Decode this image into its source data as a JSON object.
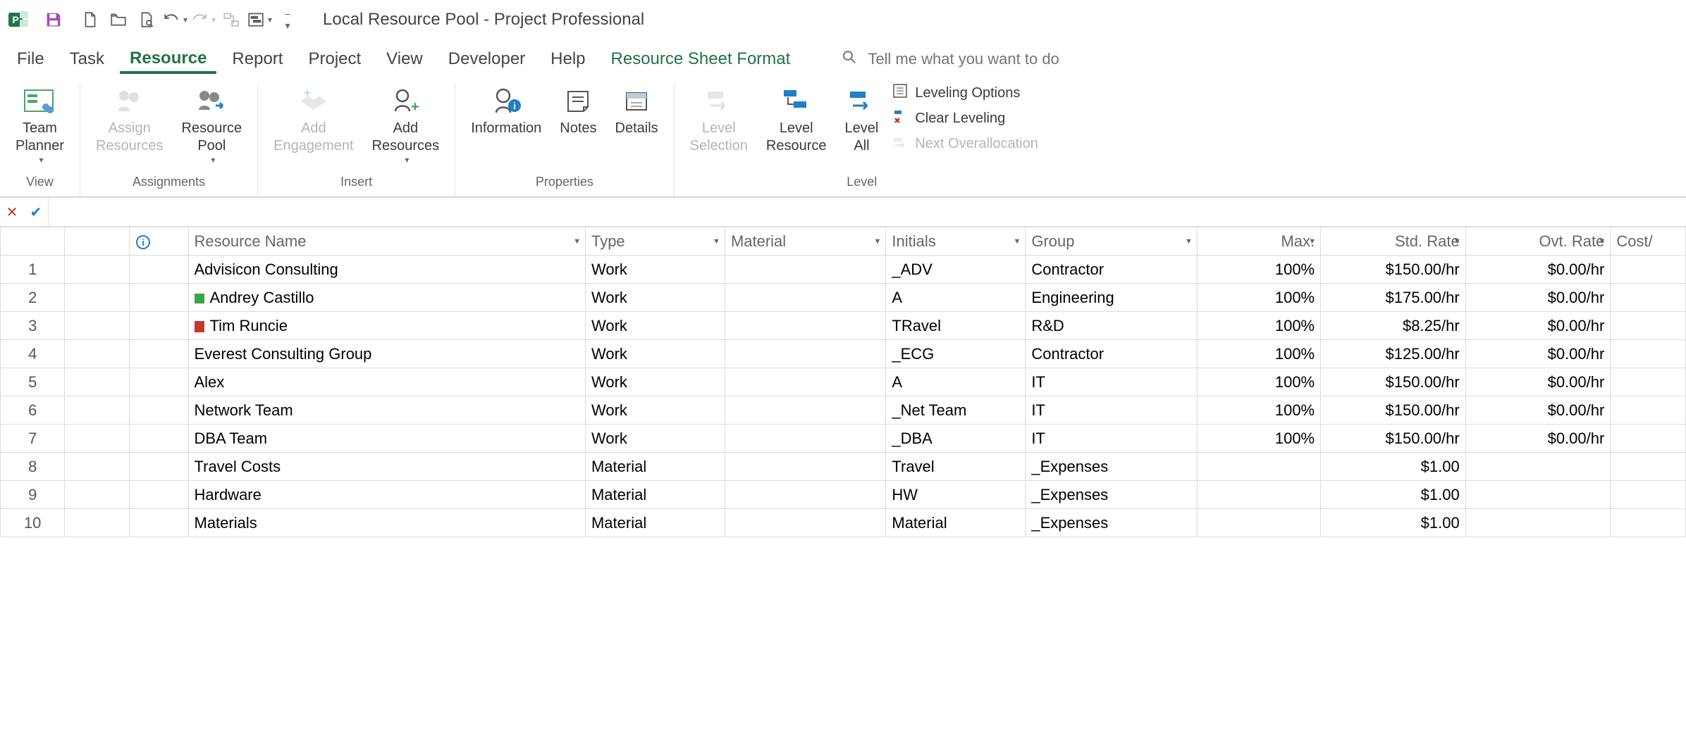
{
  "app": {
    "title": "Local Resource Pool  -  Project Professional"
  },
  "qat_tips": {
    "save": "Save",
    "new": "New",
    "open": "Open",
    "print": "Print Preview",
    "undo": "Undo",
    "redo": "Redo",
    "link": "Link",
    "gantt": "Gantt",
    "custom": "Customize"
  },
  "tabs": [
    "File",
    "Task",
    "Resource",
    "Report",
    "Project",
    "View",
    "Developer",
    "Help"
  ],
  "contextual_tab": "Resource Sheet Format",
  "tellme_placeholder": "Tell me what you want to do",
  "ribbon": {
    "groups": {
      "view": {
        "label": "View",
        "team_planner": "Team\nPlanner"
      },
      "assignments": {
        "label": "Assignments",
        "assign": "Assign\nResources",
        "pool": "Resource\nPool"
      },
      "insert": {
        "label": "Insert",
        "engagement": "Add\nEngagement",
        "add_res": "Add\nResources"
      },
      "properties": {
        "label": "Properties",
        "info": "Information",
        "notes": "Notes",
        "details": "Details"
      },
      "level": {
        "label": "Level",
        "sel": "Level\nSelection",
        "res": "Level\nResource",
        "all": "Level\nAll",
        "opts": "Leveling Options",
        "clear": "Clear Leveling",
        "next": "Next Overallocation"
      }
    }
  },
  "columns": {
    "name": "Resource Name",
    "type": "Type",
    "material": "Material",
    "initials": "Initials",
    "group": "Group",
    "max": "Max.",
    "std": "Std. Rate",
    "ovt": "Ovt. Rate",
    "cost": "Cost/"
  },
  "rows": [
    {
      "num": "1",
      "badge": "",
      "name": "Advisicon Consulting",
      "type": "Work",
      "material": "",
      "initials": "_ADV",
      "group": "Contractor",
      "max": "100%",
      "std": "$150.00/hr",
      "ovt": "$0.00/hr"
    },
    {
      "num": "2",
      "badge": "green",
      "name": "Andrey Castillo",
      "type": "Work",
      "material": "",
      "initials": "A",
      "group": "Engineering",
      "max": "100%",
      "std": "$175.00/hr",
      "ovt": "$0.00/hr"
    },
    {
      "num": "3",
      "badge": "red",
      "name": "Tim Runcie",
      "type": "Work",
      "material": "",
      "initials": "TRavel",
      "group": "R&D",
      "max": "100%",
      "std": "$8.25/hr",
      "ovt": "$0.00/hr"
    },
    {
      "num": "4",
      "badge": "",
      "name": "Everest Consulting Group",
      "type": "Work",
      "material": "",
      "initials": "_ECG",
      "group": "Contractor",
      "max": "100%",
      "std": "$125.00/hr",
      "ovt": "$0.00/hr"
    },
    {
      "num": "5",
      "badge": "",
      "name": "Alex",
      "type": "Work",
      "material": "",
      "initials": "A",
      "group": "IT",
      "max": "100%",
      "std": "$150.00/hr",
      "ovt": "$0.00/hr"
    },
    {
      "num": "6",
      "badge": "",
      "name": "Network Team",
      "type": "Work",
      "material": "",
      "initials": "_Net Team",
      "group": "IT",
      "max": "100%",
      "std": "$150.00/hr",
      "ovt": "$0.00/hr"
    },
    {
      "num": "7",
      "badge": "",
      "name": "DBA Team",
      "type": "Work",
      "material": "",
      "initials": "_DBA",
      "group": "IT",
      "max": "100%",
      "std": "$150.00/hr",
      "ovt": "$0.00/hr"
    },
    {
      "num": "8",
      "badge": "",
      "name": "Travel Costs",
      "type": "Material",
      "material": "",
      "initials": "Travel",
      "group": "_Expenses",
      "max": "",
      "std": "$1.00",
      "ovt": ""
    },
    {
      "num": "9",
      "badge": "",
      "name": "Hardware",
      "type": "Material",
      "material": "",
      "initials": "HW",
      "group": "_Expenses",
      "max": "",
      "std": "$1.00",
      "ovt": ""
    },
    {
      "num": "10",
      "badge": "",
      "name": "Materials",
      "type": "Material",
      "material": "",
      "initials": "Material",
      "group": "_Expenses",
      "max": "",
      "std": "$1.00",
      "ovt": ""
    }
  ]
}
